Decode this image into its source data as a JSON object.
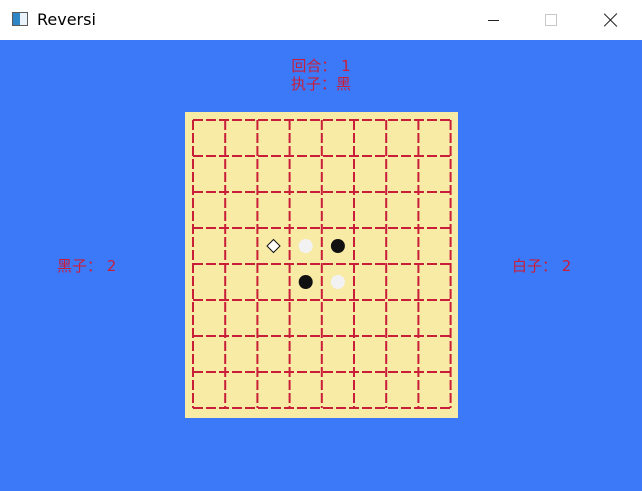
{
  "window": {
    "title": "Reversi"
  },
  "status": {
    "round": "回合： 1",
    "turn": "执子：黑"
  },
  "scores": {
    "black": "黑子： 2",
    "white": "白子： 2"
  },
  "board": {
    "rows": 8,
    "cols": 8,
    "pieces": [
      {
        "row": 3,
        "col": 3,
        "color": "white"
      },
      {
        "row": 3,
        "col": 4,
        "color": "black"
      },
      {
        "row": 4,
        "col": 3,
        "color": "black"
      },
      {
        "row": 4,
        "col": 4,
        "color": "white"
      }
    ],
    "hint": {
      "row": 3,
      "col": 2
    }
  },
  "colors": {
    "background": "#3b79f8",
    "board": "#f8eba6",
    "grid": "#c91e3a",
    "text": "#c91e3a",
    "black_piece": "#111111",
    "white_piece": "#f2f2f2"
  }
}
